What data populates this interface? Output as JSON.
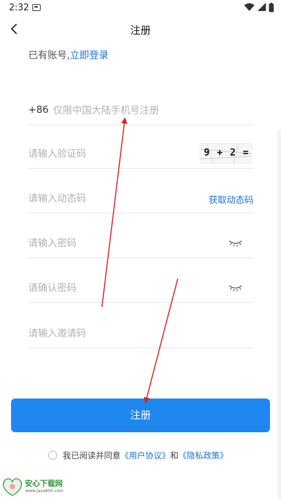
{
  "status_bar": {
    "time": "2:32"
  },
  "header": {
    "title": "注册"
  },
  "account": {
    "prompt": "已有账号,",
    "login_link": "立即登录"
  },
  "form": {
    "phone": {
      "prefix": "+86",
      "placeholder": "仅限中国大陆手机号注册",
      "value": ""
    },
    "captcha": {
      "placeholder": "请输入验证码",
      "value": "",
      "image_text": "9 + 2 ="
    },
    "sms_code": {
      "placeholder": "请输入动态码",
      "value": "",
      "get_code_label": "获取动态码"
    },
    "password": {
      "placeholder": "请输入密码",
      "value": ""
    },
    "confirm_password": {
      "placeholder": "请确认密码",
      "value": ""
    },
    "invite_code": {
      "placeholder": "请输入邀请码",
      "value": ""
    }
  },
  "register_button": {
    "label": "注册"
  },
  "agreement": {
    "prefix": "我已阅读并同意",
    "user_agreement": "《用户协议》",
    "and": "和",
    "privacy_policy": "《隐私政策》"
  },
  "watermark": {
    "title": "安心下载网",
    "url": "www.java800.com"
  },
  "colors": {
    "accent": "#1e88f0",
    "link": "#1a73d9",
    "annotation_arrow": "#e02020"
  }
}
